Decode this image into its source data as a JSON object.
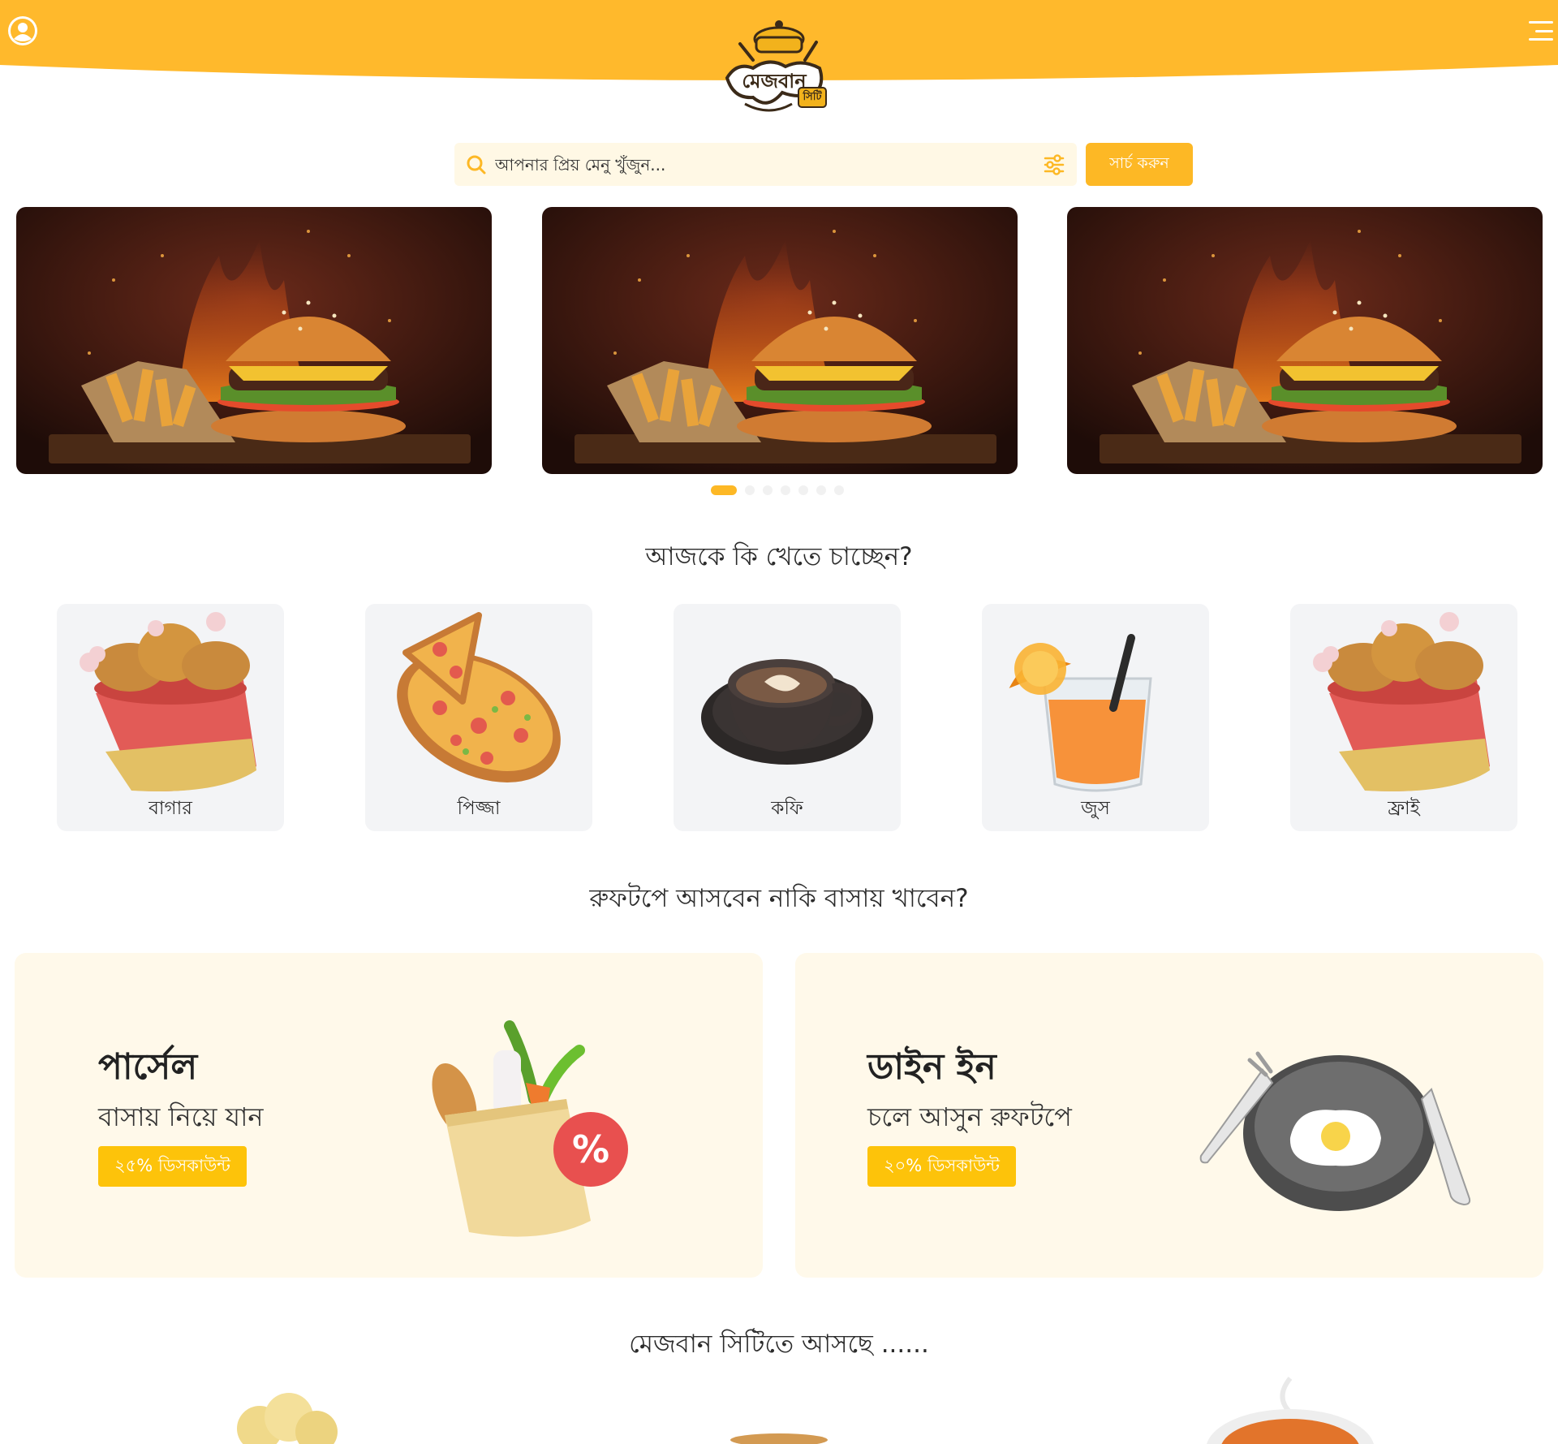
{
  "brand": {
    "logo_main": "মেজবান",
    "logo_sub": "সিটি",
    "accent": "#fdb825",
    "header_color": "#ffb92c"
  },
  "search": {
    "placeholder": "আপনার প্রিয় মেনু খুঁজুন...",
    "button_label": "সার্চ করুন"
  },
  "carousel": {
    "slides": [
      {
        "image": "burger-fries-fire"
      },
      {
        "image": "burger-fries-fire"
      },
      {
        "image": "burger-fries-fire"
      }
    ],
    "dots_count": 7,
    "active_dot": 0
  },
  "categories_section": {
    "title": "আজকে কি খেতে চাচ্ছেন?",
    "items": [
      {
        "label": "বাগার",
        "icon": "fried-chicken-bucket-icon"
      },
      {
        "label": "পিজ্জা",
        "icon": "pizza-icon"
      },
      {
        "label": "কফি",
        "icon": "coffee-cup-icon"
      },
      {
        "label": "জুস",
        "icon": "orange-juice-icon"
      },
      {
        "label": "ফ্রাই",
        "icon": "fried-chicken-bucket-icon"
      }
    ]
  },
  "service_section": {
    "title": "রুফটপে আসবেন নাকি বাসায় খাবেন?",
    "cards": [
      {
        "title": "পার্সেল",
        "subtitle": "বাসায় নিয়ে যান",
        "discount": "২৫% ডিসকাউন্ট",
        "icon": "grocery-bag-icon"
      },
      {
        "title": "ডাইন ইন",
        "subtitle": "চলে আসুন রুফটপে",
        "discount": "২০% ডিসকাউন্ট",
        "icon": "plate-cutlery-icon"
      }
    ]
  },
  "coming_section": {
    "title": "মেজবান সিটিতে আসছে ......"
  }
}
